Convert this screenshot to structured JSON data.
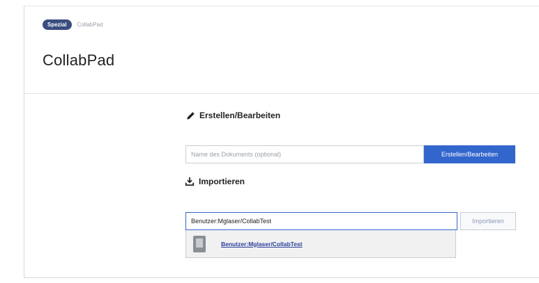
{
  "breadcrumb": {
    "badge": "Spezial",
    "page": "CollabPad"
  },
  "page": {
    "title": "CollabPad"
  },
  "create": {
    "heading": "Erstellen/Bearbeiten",
    "input_placeholder": "Name des Dokuments (optional)",
    "input_value": "",
    "button_label": "Erstellen/Bearbeiten"
  },
  "import": {
    "heading": "Importieren",
    "input_value": "Benutzer:Mglaser/CollabTest",
    "button_label": "Importieren",
    "suggestion": {
      "label": "Benutzer:Mglaser/CollabTest",
      "icon": "document-icon"
    }
  },
  "icons": {
    "create": "pencil-icon",
    "import": "download-icon"
  },
  "colors": {
    "primary": "#3366cc",
    "badge": "#3a4d80",
    "link": "#2a3f9a"
  }
}
